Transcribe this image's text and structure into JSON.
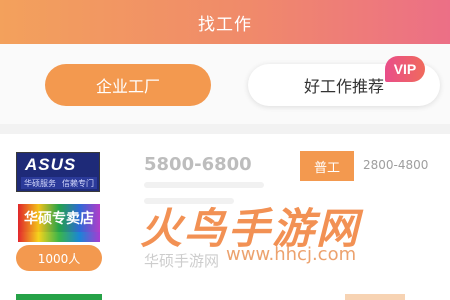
{
  "header": {
    "title": "找工作"
  },
  "tabs": [
    {
      "label": "企业工厂"
    },
    {
      "label": "好工作推荐"
    }
  ],
  "vip_badge": "VIP",
  "job": {
    "logo_brand": "ASUS",
    "logo_subtitle_left": "华硕服务",
    "logo_subtitle_right": "信赖专门",
    "store_label": "华硕专卖店",
    "company_size": "1000人",
    "salary": "5800-6800",
    "tag_label": "普工",
    "tag_salary": "2800-4800"
  },
  "watermark": {
    "text": "火鸟手游网",
    "url": "www.hhcj.com"
  },
  "faded_text": "华硕手游网"
}
